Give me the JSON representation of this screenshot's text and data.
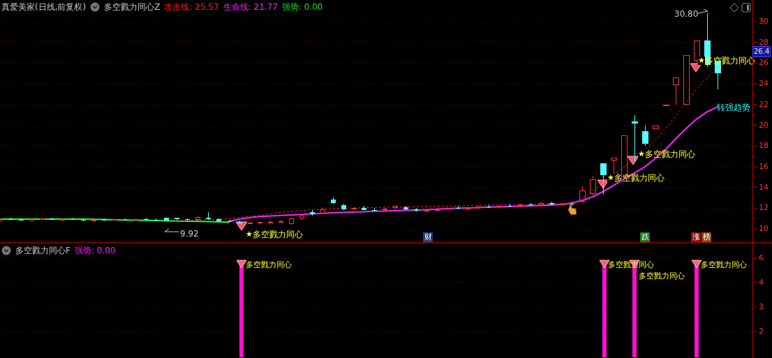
{
  "header": {
    "title": "真爱美家(日线,前复权)",
    "indicator": "多空戮力同心Z",
    "values": [
      {
        "label": "攻击线:",
        "value": "25.57",
        "color": "#ff2020"
      },
      {
        "label": "生命线:",
        "value": "21.77",
        "color": "#ff20ff"
      },
      {
        "label": "强势:",
        "value": "0.00",
        "color": "#20e020"
      }
    ]
  },
  "main_chart": {
    "y_axis_labels": [
      "30",
      "28",
      "26",
      "24",
      "22",
      "20",
      "18",
      "16",
      "14",
      "12",
      "10"
    ],
    "current_price": "26.4",
    "high_label": "30.80",
    "low_label": "9.92",
    "signals": [
      {
        "marker": "★",
        "text": "多空戮力同心"
      },
      {
        "marker": "★",
        "text": "多空戮力同心"
      },
      {
        "marker": "★",
        "text": "多空戮力同心"
      },
      {
        "marker": "★",
        "text": "多空戮力同心"
      }
    ],
    "trend_label": "转强趋势",
    "event_markers": [
      {
        "text": "财",
        "color": "#1c3f7a"
      },
      {
        "text": "跌",
        "color": "#1a7a1a"
      },
      {
        "text": "涨",
        "color": "#8a1010"
      },
      {
        "text": "榜",
        "color": "#8a4a10"
      }
    ]
  },
  "sub_chart": {
    "indicator": "多空戮力同心F",
    "values": [
      {
        "label": "强势:",
        "value": "0.00",
        "color": "#ff20ff"
      }
    ],
    "signals": [
      {
        "text": "多空戮力同心"
      },
      {
        "text": "多空戮力同心"
      },
      {
        "text": "多空戮力同心"
      },
      {
        "text": "多空戮力同心"
      }
    ],
    "y_axis_labels": [
      "6",
      "4",
      "3",
      "2"
    ]
  }
}
